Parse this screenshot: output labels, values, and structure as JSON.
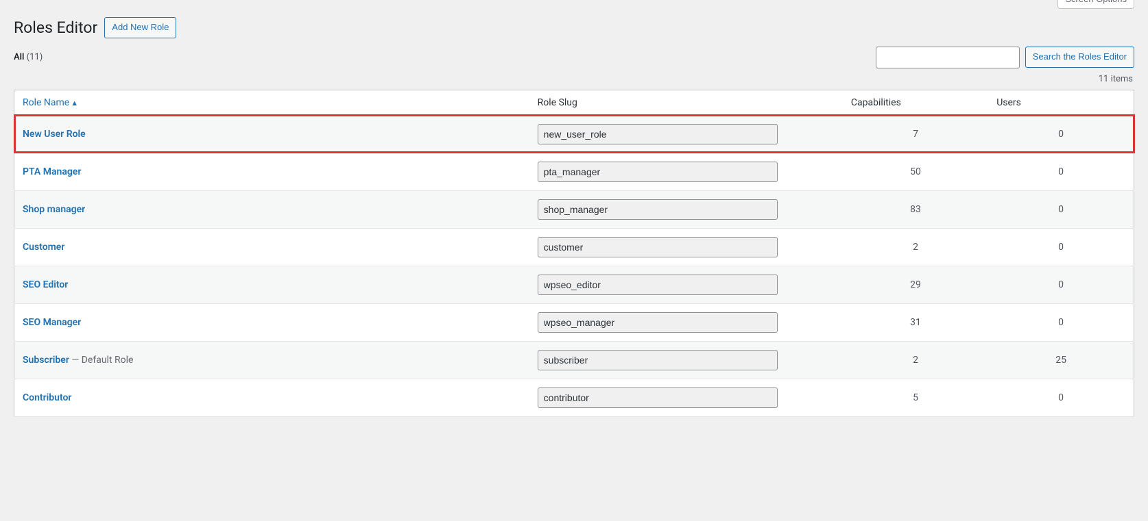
{
  "screen_options_label": "Screen Options",
  "page_title": "Roles Editor",
  "add_new_label": "Add New Role",
  "filter": {
    "all_label": "All",
    "all_count": "(11)"
  },
  "search": {
    "placeholder": "",
    "button_label": "Search the Roles Editor"
  },
  "items_count_text": "11 items",
  "columns": {
    "name": "Role Name",
    "slug": "Role Slug",
    "capabilities": "Capabilities",
    "users": "Users"
  },
  "default_role_suffix": " — Default Role",
  "roles": [
    {
      "name": "New User Role",
      "slug": "new_user_role",
      "capabilities": "7",
      "users": "0",
      "highlight": true
    },
    {
      "name": "PTA Manager",
      "slug": "pta_manager",
      "capabilities": "50",
      "users": "0"
    },
    {
      "name": "Shop manager",
      "slug": "shop_manager",
      "capabilities": "83",
      "users": "0"
    },
    {
      "name": "Customer",
      "slug": "customer",
      "capabilities": "2",
      "users": "0"
    },
    {
      "name": "SEO Editor",
      "slug": "wpseo_editor",
      "capabilities": "29",
      "users": "0"
    },
    {
      "name": "SEO Manager",
      "slug": "wpseo_manager",
      "capabilities": "31",
      "users": "0"
    },
    {
      "name": "Subscriber",
      "slug": "subscriber",
      "capabilities": "2",
      "users": "25",
      "is_default": true
    },
    {
      "name": "Contributor",
      "slug": "contributor",
      "capabilities": "5",
      "users": "0"
    }
  ]
}
